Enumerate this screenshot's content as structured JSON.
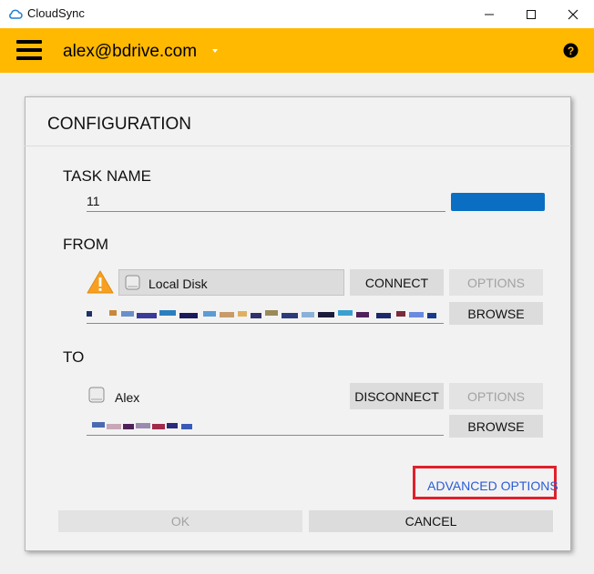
{
  "window": {
    "title": "CloudSync",
    "controls": {
      "minimize": "minimize-icon",
      "maximize": "maximize-icon",
      "close": "close-icon"
    }
  },
  "header": {
    "account": "alex@bdrive.com",
    "menu_icon": "hamburger-menu-icon",
    "help_icon": "help-icon",
    "accent_color": "#ffb900"
  },
  "dialog": {
    "title": "CONFIGURATION",
    "task": {
      "label": "TASK NAME",
      "value": "11"
    },
    "from": {
      "label": "FROM",
      "source": "Local Disk",
      "status_icon": "warning-icon",
      "connect_label": "CONNECT",
      "options_label": "OPTIONS",
      "browse_label": "BROWSE"
    },
    "to": {
      "label": "TO",
      "destination": "Alex",
      "disconnect_label": "DISCONNECT",
      "options_label": "OPTIONS",
      "browse_label": "BROWSE"
    },
    "advanced_options": "ADVANCED OPTIONS",
    "ok_label": "OK",
    "cancel_label": "CANCEL"
  }
}
